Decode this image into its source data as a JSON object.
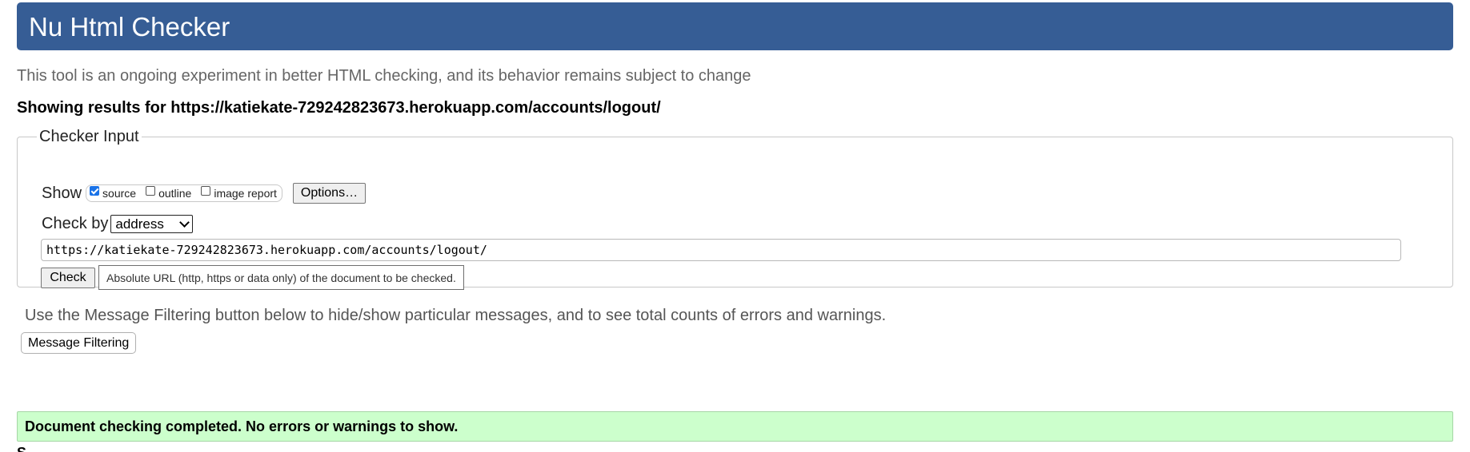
{
  "header": {
    "title": "Nu Html Checker",
    "background_color": "#365d95"
  },
  "intro": "This tool is an ongoing experiment in better HTML checking, and its behavior remains subject to change",
  "showing_results": "Showing results for https://katiekate-729242823673.herokuapp.com/accounts/logout/",
  "checker_input": {
    "legend": "Checker Input",
    "show_label": "Show",
    "show_options": [
      {
        "label": "source",
        "checked": true
      },
      {
        "label": "outline",
        "checked": false
      },
      {
        "label": "image report",
        "checked": false
      }
    ],
    "options_button": "Options…",
    "check_by_label": "Check by",
    "check_by_selected": "address",
    "url_value": "https://katiekate-729242823673.herokuapp.com/accounts/logout/",
    "check_button": "Check",
    "hint": "Absolute URL (http, https or data only) of the document to be checked."
  },
  "filtering": {
    "note": "Use the Message Filtering button below to hide/show particular messages, and to see total counts of errors and warnings.",
    "button": "Message Filtering"
  },
  "result": {
    "message": "Document checking completed. No errors or warnings to show.",
    "background_color": "#ccffcc"
  },
  "cut_off_text": "S"
}
